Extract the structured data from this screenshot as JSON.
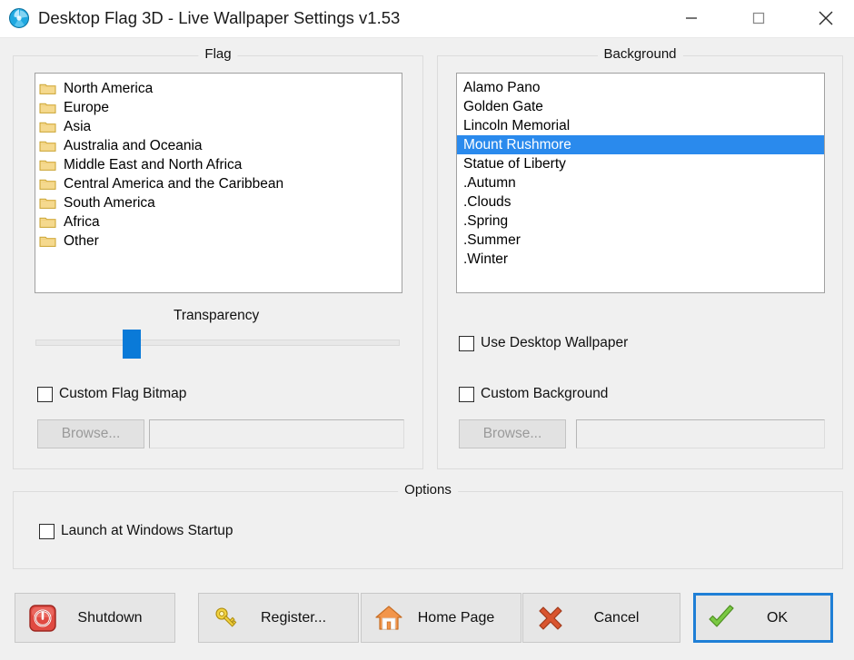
{
  "window": {
    "title": "Desktop Flag 3D - Live Wallpaper Settings  v1.53",
    "app_icon": "globe-flag-icon",
    "controls": {
      "minimize": "minimize-icon",
      "maximize": "maximize-icon",
      "close": "close-icon"
    }
  },
  "flag_group": {
    "legend": "Flag",
    "items": [
      {
        "label": "North America",
        "icon": "folder-icon"
      },
      {
        "label": "Europe",
        "icon": "folder-icon"
      },
      {
        "label": "Asia",
        "icon": "folder-icon"
      },
      {
        "label": "Australia and Oceania",
        "icon": "folder-icon"
      },
      {
        "label": "Middle East and North Africa",
        "icon": "folder-icon"
      },
      {
        "label": "Central America and the Caribbean",
        "icon": "folder-icon"
      },
      {
        "label": "South America",
        "icon": "folder-icon"
      },
      {
        "label": "Africa",
        "icon": "folder-icon"
      },
      {
        "label": "Other",
        "icon": "folder-icon"
      }
    ],
    "transparency": {
      "label": "Transparency",
      "value_percent": 25
    },
    "custom_bitmap": {
      "label": "Custom Flag Bitmap",
      "checked": false
    },
    "browse_label": "Browse...",
    "path_value": "",
    "browse_enabled": false
  },
  "background_group": {
    "legend": "Background",
    "items": [
      {
        "label": "Alamo Pano",
        "selected": false
      },
      {
        "label": "Golden Gate",
        "selected": false
      },
      {
        "label": "Lincoln Memorial",
        "selected": false
      },
      {
        "label": "Mount Rushmore",
        "selected": true
      },
      {
        "label": "Statue of Liberty",
        "selected": false
      },
      {
        "label": ".Autumn",
        "selected": false
      },
      {
        "label": ".Clouds",
        "selected": false
      },
      {
        "label": ".Spring",
        "selected": false
      },
      {
        "label": ".Summer",
        "selected": false
      },
      {
        "label": ".Winter",
        "selected": false
      }
    ],
    "use_desktop_wallpaper": {
      "label": "Use Desktop Wallpaper",
      "checked": false
    },
    "custom_background": {
      "label": "Custom Background",
      "checked": false
    },
    "browse_label": "Browse...",
    "path_value": "",
    "browse_enabled": false
  },
  "options_group": {
    "legend": "Options",
    "launch_at_startup": {
      "label": "Launch at Windows Startup",
      "checked": false
    }
  },
  "buttons": [
    {
      "label": "Shutdown",
      "icon": "power-icon"
    },
    {
      "label": "Register...",
      "icon": "key-icon"
    },
    {
      "label": "Home Page",
      "icon": "house-icon"
    },
    {
      "label": "Cancel",
      "icon": "red-x-icon"
    },
    {
      "label": "OK",
      "icon": "green-check-icon"
    }
  ],
  "colors": {
    "selection": "#2a8aed",
    "slider_thumb": "#0a7ad8",
    "focus_border": "#1f7fd6",
    "window_bg": "#f0f0f0"
  }
}
